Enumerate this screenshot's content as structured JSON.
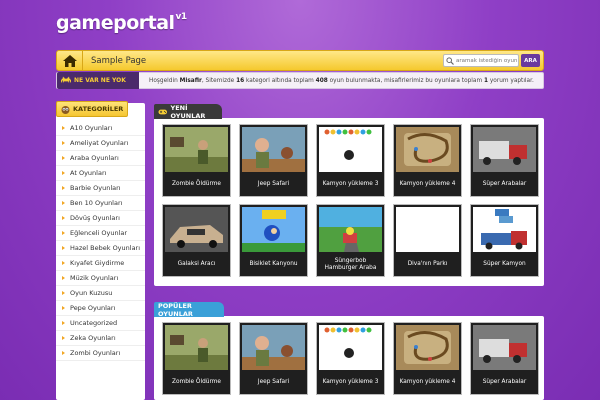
{
  "logo": {
    "name": "gameportal",
    "version": "v1"
  },
  "nav": {
    "home_label": "home-icon",
    "link": "Sample Page"
  },
  "search": {
    "placeholder": "aramak istediğin oyun",
    "button": "ARA"
  },
  "ticker": {
    "label": "NE VAR NE YOK",
    "parts": {
      "p1": "Hoşgeldin ",
      "user": "Misafir",
      "p2": ", Sitemizde ",
      "cats": "16",
      "p3": " kategori altında toplam ",
      "games": "408",
      "p4": " oyun bulunmakta, misafirlerimiz bu oyunlara toplam ",
      "comments": "1",
      "p5": " yorum yaptılar."
    }
  },
  "sidebar": {
    "title": "KATEGORİLER",
    "items": [
      "A10 Oyunları",
      "Ameliyat Oyunları",
      "Araba Oyunları",
      "At Oyunları",
      "Barbie Oyunları",
      "Ben 10 Oyunları",
      "Dövüş Oyunları",
      "Eğlenceli Oyunlar",
      "Hazel Bebek Oyunları",
      "Kıyafet Giydirme",
      "Müzik Oyunları",
      "Oyun Kuzusu",
      "Pepe Oyunları",
      "Uncategorized",
      "Zeka Oyunları",
      "Zombi Oyunları"
    ]
  },
  "new_games": {
    "title": "YENİ OYUNLAR",
    "items": [
      "Zombie Öldürme",
      "Jeep Safari",
      "Kamyon yükleme 3",
      "Kamyon yükleme 4",
      "Süper Arabalar",
      "Galaksi Aracı",
      "Bisiklet Kanyonu",
      "Süngerbob Hamburger Araba",
      "Diva'nın Parkı",
      "Süper Kamyon"
    ]
  },
  "popular_games": {
    "title": "POPÜLER OYUNLAR",
    "items": [
      "Zombie Öldürme",
      "Jeep Safari",
      "Kamyon yükleme 3",
      "Kamyon yükleme 4",
      "Süper Arabalar"
    ]
  },
  "colors": {
    "background": "#8f3fc6",
    "nav_yellow": "#f5c92e",
    "ticker_dark": "#4b2a6b",
    "popular_blue": "#3aa0d8"
  }
}
